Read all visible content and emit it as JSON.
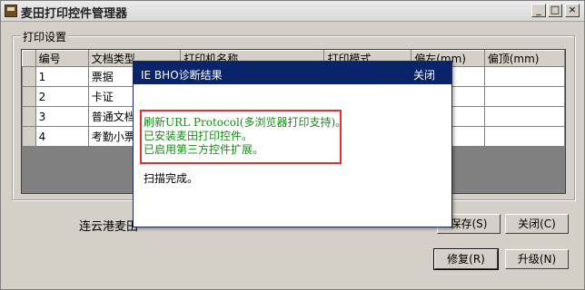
{
  "window": {
    "title": "麦田打印控件管理器",
    "controls": {
      "minimize": "_",
      "maximize": "□",
      "close": "×"
    }
  },
  "group": {
    "label": "打印设置",
    "columns": [
      "编号",
      "文档类型",
      "打印机名称",
      "打印模式",
      "偏左(mm)",
      "偏顶(mm)"
    ],
    "rows": [
      {
        "id": "1",
        "type": "票据"
      },
      {
        "id": "2",
        "type": "卡证"
      },
      {
        "id": "3",
        "type": "普通文档"
      },
      {
        "id": "4",
        "type": "考勤小票"
      }
    ]
  },
  "footer": {
    "company": "连云港麦田",
    "save_button": "保存(S)",
    "close_button": "关闭(C)",
    "repair_button": "修复(R)",
    "upgrade_button": "升级(N)"
  },
  "dialog": {
    "title": "IE BHO诊断结果",
    "close_label": "关闭",
    "results": [
      "刷新URL Protocol(多浏览器打印支持)。",
      "已安装麦田打印控件。",
      "已启用第三方控件扩展。"
    ],
    "status": "扫描完成。"
  },
  "colors": {
    "dialog_title_bar": "#0a246a",
    "result_text": "#1a8a1a",
    "highlight_border": "#e03030"
  }
}
